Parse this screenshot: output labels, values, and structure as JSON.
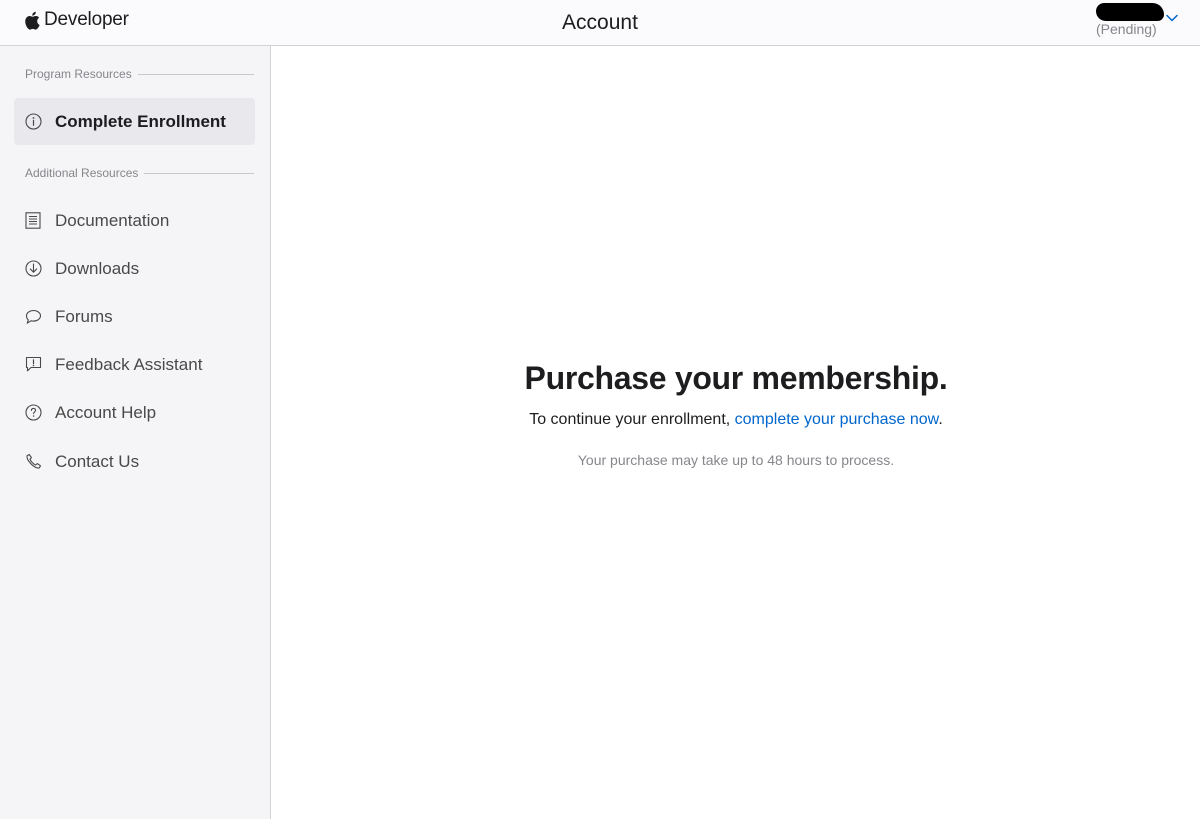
{
  "header": {
    "brand": "Developer",
    "title": "Account",
    "account_status": "(Pending)"
  },
  "sidebar": {
    "program_label": "Program Resources",
    "program_items": [
      {
        "label": "Complete Enrollment",
        "icon": "info-circle-icon",
        "active": true
      }
    ],
    "additional_label": "Additional Resources",
    "additional_items": [
      {
        "label": "Documentation",
        "icon": "document-icon"
      },
      {
        "label": "Downloads",
        "icon": "download-circle-icon"
      },
      {
        "label": "Forums",
        "icon": "chat-bubble-icon"
      },
      {
        "label": "Feedback Assistant",
        "icon": "feedback-icon"
      },
      {
        "label": "Account Help",
        "icon": "question-circle-icon"
      },
      {
        "label": "Contact Us",
        "icon": "phone-icon"
      }
    ]
  },
  "main": {
    "title": "Purchase your membership.",
    "text_prefix": "To continue your enrollment, ",
    "link_text": "complete your purchase now",
    "text_suffix": ".",
    "note": "Your purchase may take up to 48 hours to process."
  },
  "colors": {
    "link": "#0066cc",
    "sidebar_bg": "#f5f5f7",
    "active_item_bg": "#e8e8ed"
  }
}
